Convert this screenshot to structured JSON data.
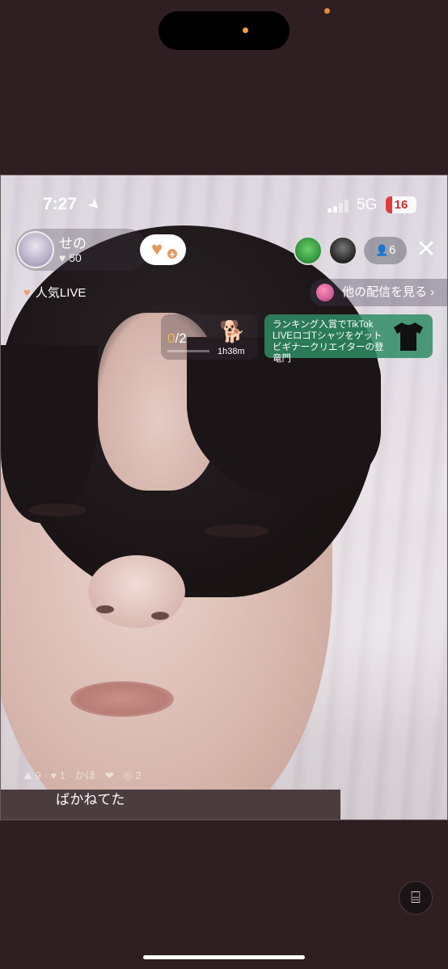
{
  "status_bar": {
    "time": "7:27",
    "network": "5G",
    "battery": "16"
  },
  "host": {
    "name": "せの",
    "likes": "50"
  },
  "viewers": {
    "count": "6"
  },
  "popular_live": "人気LIVE",
  "other_streams": "他の配信を見る ›",
  "goal": {
    "current": "0",
    "total": "/2",
    "time": "1h38m",
    "progress_fraction": 0
  },
  "promo": {
    "line1": "ランキング入賞でTikTok",
    "line2": "LIVEロゴTシャツをゲット",
    "line3": "ビギナークリエイターの登竜門"
  },
  "comment": {
    "text": "ばかねてた"
  },
  "colors": {
    "background": "#2f1f22",
    "accent_orange": "#e39a5f",
    "promo_green": "#2e8c64"
  },
  "icons": [
    "location-arrow-icon",
    "signal-icon",
    "battery-icon",
    "heart-icon",
    "plus-icon",
    "person-icon",
    "close-icon",
    "planet-icon",
    "corgi-icon",
    "tshirt-icon",
    "scan-text-icon"
  ]
}
